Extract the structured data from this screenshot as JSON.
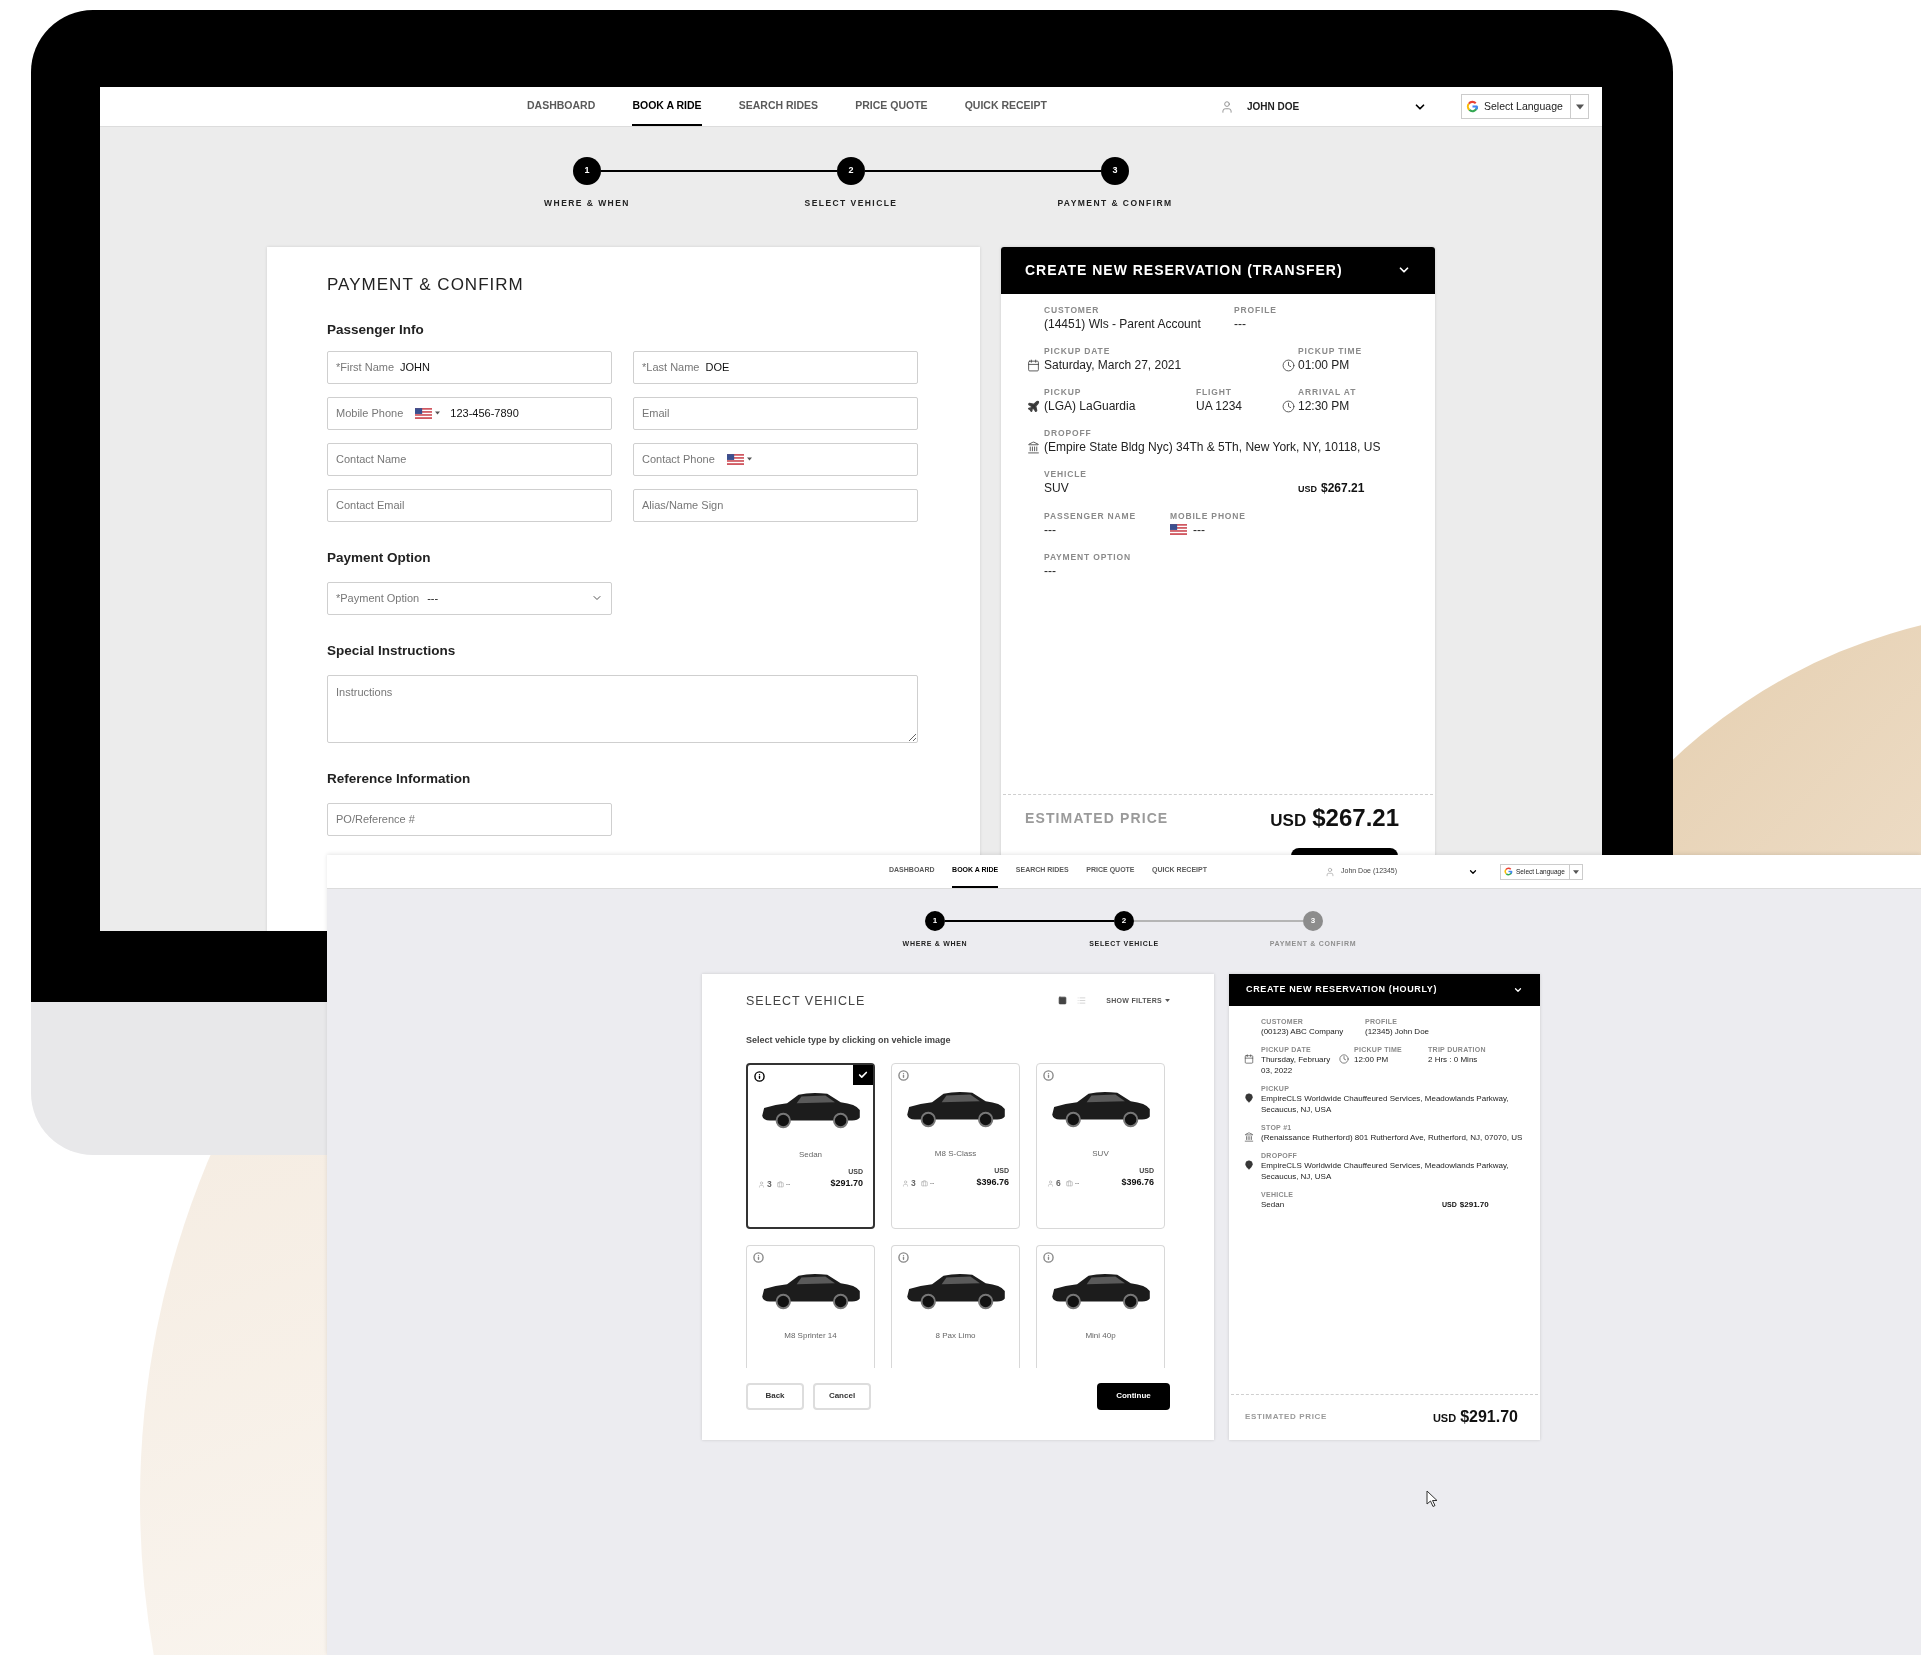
{
  "back_screen": {
    "nav": {
      "items": [
        {
          "label": "DASHBOARD",
          "selected": false
        },
        {
          "label": "BOOK A RIDE",
          "selected": true
        },
        {
          "label": "SEARCH RIDES",
          "selected": false
        },
        {
          "label": "PRICE QUOTE",
          "selected": false
        },
        {
          "label": "QUICK RECEIPT",
          "selected": false
        }
      ],
      "user": "JOHN DOE",
      "language": "Select Language"
    },
    "steps": [
      {
        "number": "1",
        "label": "WHERE & WHEN",
        "reached": true
      },
      {
        "number": "2",
        "label": "SELECT VEHICLE",
        "reached": true
      },
      {
        "number": "3",
        "label": "PAYMENT & CONFIRM",
        "reached": true
      }
    ],
    "payment_form": {
      "title": "PAYMENT & CONFIRM",
      "sections": [
        {
          "heading": "Passenger Info",
          "fields": [
            {
              "kind": "text",
              "label": "*First Name",
              "value": "JOHN"
            },
            {
              "kind": "text",
              "label": "*Last Name",
              "value": "DOE"
            },
            {
              "kind": "phone",
              "label": "Mobile Phone",
              "value": "123-456-7890"
            },
            {
              "kind": "text",
              "placeholder": "Email"
            },
            {
              "kind": "text",
              "placeholder": "Contact Name"
            },
            {
              "kind": "phone",
              "label": "Contact Phone"
            },
            {
              "kind": "text",
              "placeholder": "Contact Email"
            },
            {
              "kind": "text",
              "placeholder": "Alias/Name Sign"
            }
          ]
        },
        {
          "heading": "Payment Option",
          "fields": [
            {
              "kind": "select",
              "label": "*Payment Option",
              "value": "---"
            }
          ]
        },
        {
          "heading": "Special Instructions",
          "fields": [
            {
              "kind": "textarea",
              "placeholder": "Instructions"
            }
          ]
        },
        {
          "heading": "Reference Information",
          "fields": [
            {
              "kind": "text",
              "placeholder": "PO/Reference #"
            }
          ]
        }
      ]
    },
    "summary": {
      "title": "CREATE NEW RESERVATION (TRANSFER)",
      "rows": [
        {
          "fields": [
            {
              "kind": "plain",
              "label": "CUSTOMER",
              "value": "(14451) Wls - Parent Account"
            },
            {
              "kind": "plain",
              "label": "PROFILE",
              "value": "---"
            }
          ]
        },
        {
          "fields": [
            {
              "kind": "date",
              "label": "PICKUP DATE",
              "value": "Saturday, March 27, 2021"
            },
            {
              "kind": "time",
              "label": "PICKUP TIME",
              "value": "01:00 PM"
            }
          ]
        },
        {
          "fields": [
            {
              "kind": "airport",
              "label": "PICKUP",
              "value": "(LGA) LaGuardia"
            },
            {
              "kind": "plain",
              "label": "FLIGHT",
              "value": "UA 1234"
            },
            {
              "kind": "time",
              "label": "ARRIVAL AT",
              "value": "12:30 PM"
            }
          ]
        },
        {
          "fields": [
            {
              "kind": "place",
              "label": "DROPOFF",
              "value": "(Empire State Bldg Nyc) 34Th & 5Th, New York, NY, 10118, US"
            }
          ]
        },
        {
          "fields": [
            {
              "kind": "plain",
              "label": "VEHICLE",
              "value": "SUV"
            },
            {
              "kind": "price",
              "currency": "USD",
              "amount": "$267.21"
            }
          ]
        },
        {
          "fields": [
            {
              "kind": "plain",
              "label": "PASSENGER NAME",
              "value": "---"
            },
            {
              "kind": "phone",
              "label": "MOBILE PHONE",
              "value": "---"
            }
          ]
        },
        {
          "fields": [
            {
              "kind": "plain",
              "label": "PAYMENT OPTION",
              "value": "---"
            }
          ]
        }
      ],
      "estimate": {
        "label": "ESTIMATED PRICE",
        "currency": "USD",
        "amount": "$267.21"
      }
    }
  },
  "front_screen": {
    "nav": {
      "items": [
        {
          "label": "DASHBOARD",
          "selected": false
        },
        {
          "label": "BOOK A RIDE",
          "selected": true
        },
        {
          "label": "SEARCH RIDES",
          "selected": false
        },
        {
          "label": "PRICE QUOTE",
          "selected": false
        },
        {
          "label": "QUICK RECEIPT",
          "selected": false
        }
      ],
      "user": "John Doe (12345)",
      "language": "Select Language"
    },
    "steps": [
      {
        "number": "1",
        "label": "WHERE & WHEN",
        "reached": true
      },
      {
        "number": "2",
        "label": "SELECT VEHICLE",
        "reached": true
      },
      {
        "number": "3",
        "label": "PAYMENT & CONFIRM",
        "reached": false
      }
    ],
    "vehicle_picker": {
      "title": "SELECT VEHICLE",
      "view_buttons": [
        {
          "kind": "grid",
          "selected": true
        },
        {
          "kind": "list",
          "selected": false
        }
      ],
      "filters": "SHOW FILTERS",
      "instruction": "Select vehicle type by clicking on vehicle image",
      "vehicles": [
        {
          "name": "Sedan",
          "selected": true,
          "passengers": "3",
          "luggage": "--",
          "currency": "USD",
          "price": "$291.70"
        },
        {
          "name": "M8 S-Class",
          "selected": false,
          "passengers": "3",
          "luggage": "--",
          "currency": "USD",
          "price": "$396.76"
        },
        {
          "name": "SUV",
          "selected": false,
          "passengers": "6",
          "luggage": "--",
          "currency": "USD",
          "price": "$396.76"
        },
        {
          "name": "M8 Sprinter 14",
          "selected": false
        },
        {
          "name": "8 Pax Limo",
          "selected": false
        },
        {
          "name": "Mini 40p",
          "selected": false
        }
      ],
      "buttons": [
        {
          "kind": "outline",
          "label": "Back"
        },
        {
          "kind": "outline",
          "label": "Cancel"
        },
        {
          "kind": "primary",
          "label": "Continue"
        }
      ]
    },
    "summary": {
      "title": "CREATE NEW RESERVATION (HOURLY)",
      "rows": [
        {
          "fields": [
            {
              "kind": "plain",
              "label": "CUSTOMER",
              "value": "(00123) ABC Company"
            },
            {
              "kind": "plain",
              "label": "PROFILE",
              "value": "(12345) John Doe"
            }
          ]
        },
        {
          "fields": [
            {
              "kind": "date",
              "label": "PICKUP DATE",
              "value": "Thursday, February 03, 2022"
            },
            {
              "kind": "time",
              "label": "PICKUP TIME",
              "value": "12:00 PM"
            },
            {
              "kind": "plain",
              "label": "TRIP DURATION",
              "value": "2 Hrs : 0 Mins"
            }
          ]
        },
        {
          "fields": [
            {
              "kind": "location",
              "label": "PICKUP",
              "value": "EmpireCLS Worldwide Chauffeured Services, Meadowlands Parkway, Secaucus, NJ, USA"
            }
          ]
        },
        {
          "fields": [
            {
              "kind": "place",
              "label": "STOP #1",
              "value": "(Renaissance Rutherford) 801 Rutherford Ave, Rutherford, NJ, 07070, US"
            }
          ]
        },
        {
          "fields": [
            {
              "kind": "location",
              "label": "DROPOFF",
              "value": "EmpireCLS Worldwide Chauffeured Services, Meadowlands Parkway, Secaucus, NJ, USA"
            }
          ]
        },
        {
          "fields": [
            {
              "kind": "plain",
              "label": "VEHICLE",
              "value": "Sedan"
            },
            {
              "kind": "price",
              "currency": "USD",
              "amount": "$291.70"
            }
          ]
        }
      ],
      "estimate": {
        "label": "ESTIMATED PRICE",
        "currency": "USD",
        "amount": "$291.70"
      }
    }
  }
}
